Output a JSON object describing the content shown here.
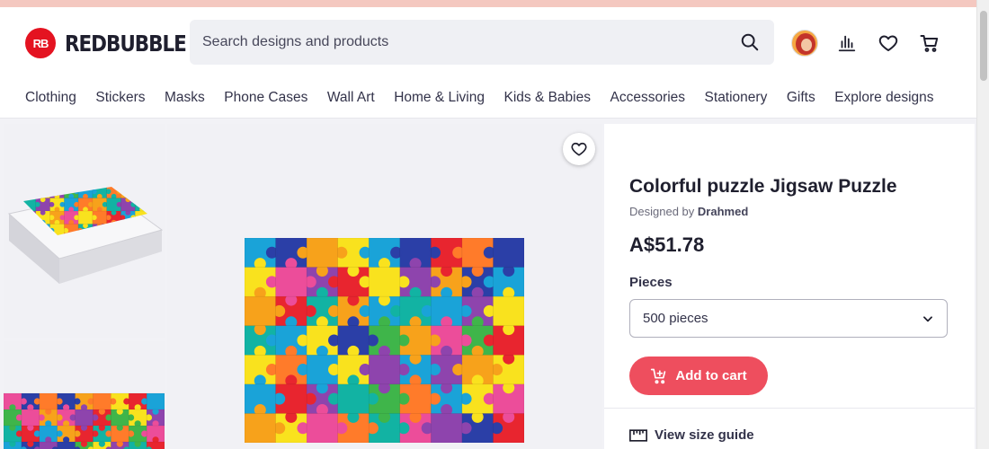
{
  "header": {
    "logo_mark": "RB",
    "logo_text": "REDBUBBLE",
    "search_placeholder": "Search designs and products"
  },
  "nav": [
    "Clothing",
    "Stickers",
    "Masks",
    "Phone Cases",
    "Wall Art",
    "Home & Living",
    "Kids & Babies",
    "Accessories",
    "Stationery",
    "Gifts",
    "Explore designs"
  ],
  "product": {
    "title": "Colorful puzzle Jigsaw Puzzle",
    "designed_by_prefix": "Designed by",
    "designer": "Drahmed",
    "price": "A$51.78",
    "pieces_label": "Pieces",
    "pieces_selected": "500 pieces",
    "add_to_cart": "Add to cart",
    "size_guide": "View size guide"
  },
  "colors": {
    "brand_red": "#e41321",
    "cart_button": "#ee4e5e",
    "puzzle_palette": [
      "#e8252f",
      "#f7a21b",
      "#f9e21e",
      "#3fb54a",
      "#1aa3d8",
      "#2b3fa7",
      "#8e44ad",
      "#ec4d9a",
      "#ff7b2a",
      "#12b3a3"
    ]
  },
  "icons": [
    "search-icon",
    "avatar",
    "stats-icon",
    "heart-icon",
    "cart-icon",
    "favorite-heart-icon",
    "chevron-down-icon",
    "add-to-cart-icon",
    "ruler-icon"
  ]
}
